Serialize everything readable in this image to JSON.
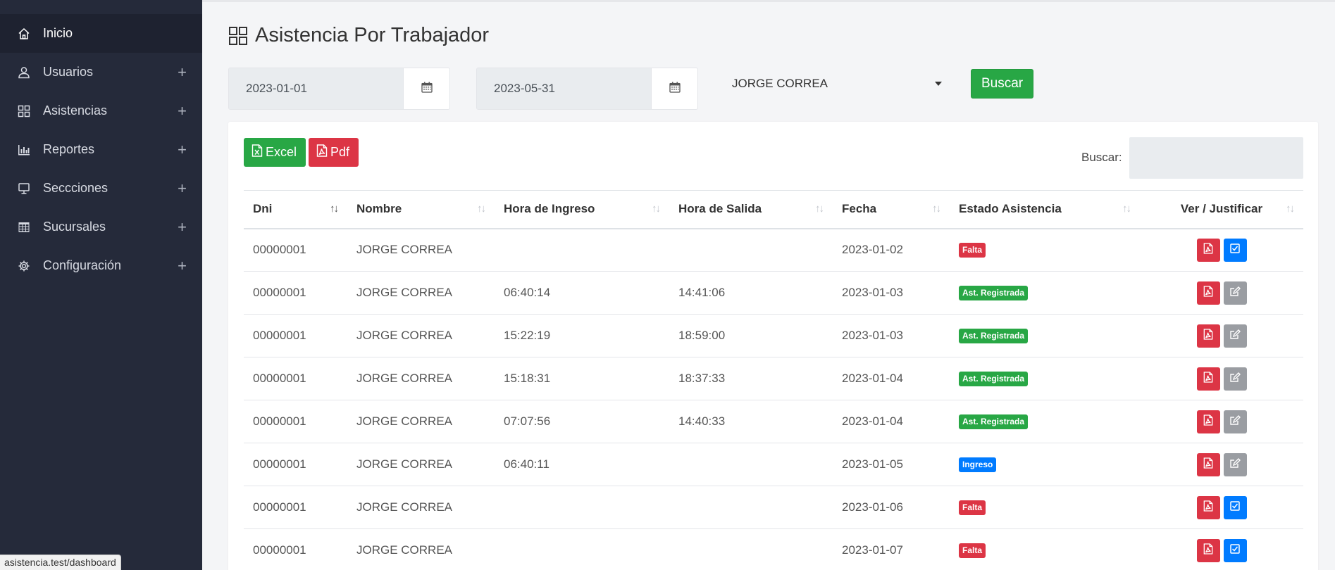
{
  "sidebar": {
    "items": [
      {
        "label": "Inicio",
        "icon": "home-icon",
        "active": true,
        "expandable": false
      },
      {
        "label": "Usuarios",
        "icon": "user-icon",
        "active": false,
        "expandable": true
      },
      {
        "label": "Asistencias",
        "icon": "grid-icon",
        "active": false,
        "expandable": true
      },
      {
        "label": "Reportes",
        "icon": "bar-chart-icon",
        "active": false,
        "expandable": true
      },
      {
        "label": "Seccciones",
        "icon": "monitor-icon",
        "active": false,
        "expandable": true
      },
      {
        "label": "Sucursales",
        "icon": "table-icon",
        "active": false,
        "expandable": true
      },
      {
        "label": "Configuración",
        "icon": "gear-icon",
        "active": false,
        "expandable": true
      }
    ],
    "expand_symbol": "+"
  },
  "status_url": "asistencia.test/dashboard",
  "page_title": "Asistencia Por Trabajador",
  "filters": {
    "date_from": "2023-01-01",
    "date_to": "2023-05-31",
    "worker": "JORGE CORREA",
    "search_button": "Buscar"
  },
  "toolbar": {
    "excel_label": "Excel",
    "pdf_label": "Pdf",
    "search_label": "Buscar:",
    "search_value": ""
  },
  "table": {
    "columns": [
      "Dni",
      "Nombre",
      "Hora de Ingreso",
      "Hora de Salida",
      "Fecha",
      "Estado Asistencia",
      "Ver / Justificar"
    ],
    "rows": [
      {
        "dni": "00000001",
        "nombre": "JORGE CORREA",
        "ingreso": "",
        "salida": "",
        "fecha": "2023-01-02",
        "estado": "Falta",
        "estado_color": "red",
        "action": "check"
      },
      {
        "dni": "00000001",
        "nombre": "JORGE CORREA",
        "ingreso": "06:40:14",
        "salida": "14:41:06",
        "fecha": "2023-01-03",
        "estado": "Ast. Registrada",
        "estado_color": "green",
        "action": "edit"
      },
      {
        "dni": "00000001",
        "nombre": "JORGE CORREA",
        "ingreso": "15:22:19",
        "salida": "18:59:00",
        "fecha": "2023-01-03",
        "estado": "Ast. Registrada",
        "estado_color": "green",
        "action": "edit"
      },
      {
        "dni": "00000001",
        "nombre": "JORGE CORREA",
        "ingreso": "15:18:31",
        "salida": "18:37:33",
        "fecha": "2023-01-04",
        "estado": "Ast. Registrada",
        "estado_color": "green",
        "action": "edit"
      },
      {
        "dni": "00000001",
        "nombre": "JORGE CORREA",
        "ingreso": "07:07:56",
        "salida": "14:40:33",
        "fecha": "2023-01-04",
        "estado": "Ast. Registrada",
        "estado_color": "green",
        "action": "edit"
      },
      {
        "dni": "00000001",
        "nombre": "JORGE CORREA",
        "ingreso": "06:40:11",
        "salida": "",
        "fecha": "2023-01-05",
        "estado": "Ingreso",
        "estado_color": "blue",
        "action": "edit"
      },
      {
        "dni": "00000001",
        "nombre": "JORGE CORREA",
        "ingreso": "",
        "salida": "",
        "fecha": "2023-01-06",
        "estado": "Falta",
        "estado_color": "red",
        "action": "check"
      },
      {
        "dni": "00000001",
        "nombre": "JORGE CORREA",
        "ingreso": "",
        "salida": "",
        "fecha": "2023-01-07",
        "estado": "Falta",
        "estado_color": "red",
        "action": "check"
      }
    ]
  },
  "colors": {
    "sidebar_bg": "#252a3a",
    "success": "#28a745",
    "danger": "#dc3545",
    "primary": "#007bff",
    "secondary": "#9a9da2"
  }
}
